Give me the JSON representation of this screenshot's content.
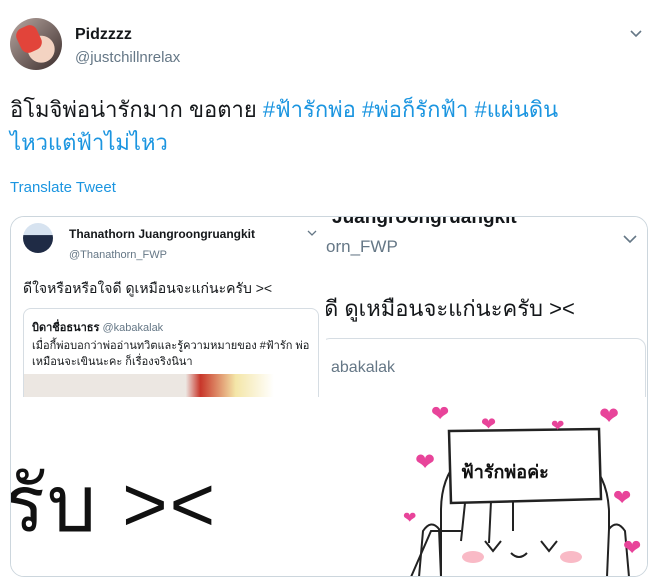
{
  "user": {
    "display_name": "Pidzzzz",
    "handle": "@justchillnrelax"
  },
  "tweet": {
    "text_plain": "อิโมจิพ่อน่ารักมาก ขอตาย ",
    "hashtags": [
      "#ฟ้ารักพ่อ",
      "#พ่อก็รักฟ้า",
      "#แผ่นดิน",
      "ไหวแต่ฟ้าไม่ไหว"
    ],
    "translate_label": "Translate Tweet"
  },
  "embedded": {
    "author_name": "Thanathorn Juangroongruangkit",
    "author_handle": "@Thanathorn_FWP",
    "text": "ดีใจหรือหรือใจดี ดูเหมือนจะแก่นะครับ ><",
    "quoted_name": "บิดาชื่อธนาธร",
    "quoted_handle": "@kabakalak",
    "quoted_text": "เมื่อกี้พ่อบอกว่าพ่ออ่านทวิตและรู้ความหมายของ #ฟ้ารัก พ่อ เหมือนจะเขินนะคะ ก็เรื่องจริงนินา"
  },
  "zoomed": {
    "name_fragment": "Juangroongruangkit",
    "handle_fragment": "orn_FWP",
    "text_fragment": "ดี ดูเหมือนจะแก่นะครับ ><",
    "quoted_handle_fragment": "abakalak"
  },
  "bottom": {
    "big_text": "รับ ><",
    "sign_text": "ฟ้ารักพ่อค่ะ"
  },
  "colors": {
    "link": "#1b95e0",
    "secondary": "#657786",
    "heart": "#e8449a"
  },
  "icons": {
    "caret": "chevron-down-icon"
  }
}
